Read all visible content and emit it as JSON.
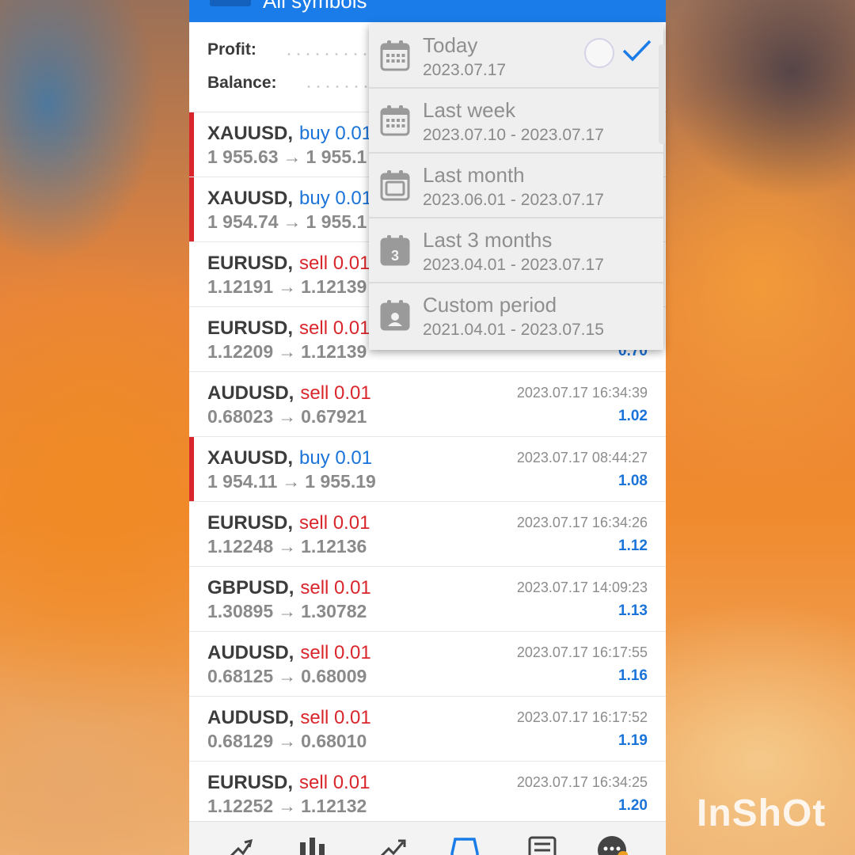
{
  "header": {
    "title": "All symbols"
  },
  "summary": {
    "profit_label": "Profit:",
    "balance_label": "Balance:"
  },
  "trades": [
    {
      "symbol": "XAUUSD",
      "type": "buy",
      "volume": "0.01",
      "open_price": "1 955.63",
      "close_price": "1 955.1",
      "time": "",
      "profit": "",
      "open": true
    },
    {
      "symbol": "XAUUSD",
      "type": "buy",
      "volume": "0.01",
      "open_price": "1 954.74",
      "close_price": "1 955.1",
      "time": "",
      "profit": "",
      "open": true
    },
    {
      "symbol": "EURUSD",
      "type": "sell",
      "volume": "0.01",
      "open_price": "1.12191",
      "close_price": "1.12139",
      "time": "",
      "profit": "",
      "open": false
    },
    {
      "symbol": "EURUSD",
      "type": "sell",
      "volume": "0.01",
      "open_price": "1.12209",
      "close_price": "1.12139",
      "time": "",
      "profit": "0.70",
      "open": false
    },
    {
      "symbol": "AUDUSD",
      "type": "sell",
      "volume": "0.01",
      "open_price": "0.68023",
      "close_price": "0.67921",
      "time": "2023.07.17 16:34:39",
      "profit": "1.02",
      "open": false
    },
    {
      "symbol": "XAUUSD",
      "type": "buy",
      "volume": "0.01",
      "open_price": "1 954.11",
      "close_price": "1 955.19",
      "time": "2023.07.17 08:44:27",
      "profit": "1.08",
      "open": true
    },
    {
      "symbol": "EURUSD",
      "type": "sell",
      "volume": "0.01",
      "open_price": "1.12248",
      "close_price": "1.12136",
      "time": "2023.07.17 16:34:26",
      "profit": "1.12",
      "open": false
    },
    {
      "symbol": "GBPUSD",
      "type": "sell",
      "volume": "0.01",
      "open_price": "1.30895",
      "close_price": "1.30782",
      "time": "2023.07.17 14:09:23",
      "profit": "1.13",
      "open": false
    },
    {
      "symbol": "AUDUSD",
      "type": "sell",
      "volume": "0.01",
      "open_price": "0.68125",
      "close_price": "0.68009",
      "time": "2023.07.17 16:17:55",
      "profit": "1.16",
      "open": false
    },
    {
      "symbol": "AUDUSD",
      "type": "sell",
      "volume": "0.01",
      "open_price": "0.68129",
      "close_price": "0.68010",
      "time": "2023.07.17 16:17:52",
      "profit": "1.19",
      "open": false
    },
    {
      "symbol": "EURUSD",
      "type": "sell",
      "volume": "0.01",
      "open_price": "1.12252",
      "close_price": "1.12132",
      "time": "2023.07.17 16:34:25",
      "profit": "1.20",
      "open": false
    }
  ],
  "period_menu": {
    "items": [
      {
        "title": "Today",
        "range": "2023.07.17",
        "icon": "calendar-today-icon",
        "selected": true
      },
      {
        "title": "Last week",
        "range": "2023.07.10 - 2023.07.17",
        "icon": "calendar-week-icon",
        "selected": false
      },
      {
        "title": "Last month",
        "range": "2023.06.01 - 2023.07.17",
        "icon": "calendar-month-icon",
        "selected": false
      },
      {
        "title": "Last 3 months",
        "range": "2023.04.01 - 2023.07.17",
        "icon": "calendar-3-months-icon",
        "icon_text": "3",
        "selected": false
      },
      {
        "title": "Custom period",
        "range": "2021.04.01 - 2023.07.15",
        "icon": "calendar-custom-icon",
        "selected": false
      }
    ]
  },
  "bottom_nav": [
    "quotes-icon",
    "chart-icon",
    "trade-icon",
    "history-icon",
    "news-icon",
    "more-icon"
  ],
  "watermark": "InShOt",
  "colors": {
    "header": "#1a7ce8",
    "buy": "#1a73d9",
    "sell": "#d9262c",
    "profit": "#1a73d9",
    "open_marker": "#d9262c"
  }
}
